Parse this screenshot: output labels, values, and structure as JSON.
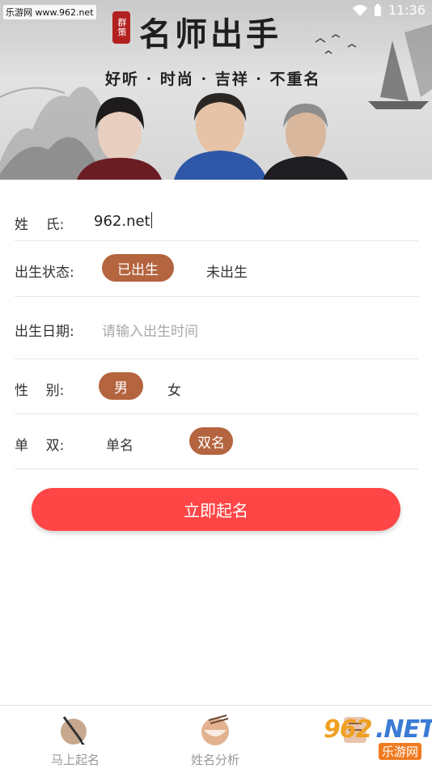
{
  "status_bar": {
    "watermark": "乐游网 www.962.net",
    "time": "11:36",
    "icons": [
      "wifi-icon",
      "battery-icon"
    ]
  },
  "banner": {
    "seal_text": "群策",
    "title": "名师出手",
    "slogan": "好听 · 时尚 · 吉祥 · 不重名"
  },
  "form": {
    "surname": {
      "label": "姓    氏:",
      "value": "962.net"
    },
    "birth_status": {
      "label": "出生状态:",
      "options": [
        "已出生",
        "未出生"
      ],
      "selected": "已出生"
    },
    "birth_date": {
      "label": "出生日期:",
      "placeholder": "请输入出生时间"
    },
    "gender": {
      "label": "性    别:",
      "options": [
        "男",
        "女"
      ],
      "selected": "男"
    },
    "name_length": {
      "label": "单    双:",
      "options": [
        "单名",
        "双名"
      ],
      "selected": "双名"
    }
  },
  "submit_label": "立即起名",
  "colors": {
    "accent": "#b4643f",
    "submit": "#ff4646",
    "nav_text": "#999999"
  },
  "bottom_nav": [
    {
      "label": "马上起名",
      "icon": "brush-icon"
    },
    {
      "label": "姓名分析",
      "icon": "bowl-icon"
    },
    {
      "label": "",
      "icon": "scroll-icon"
    }
  ],
  "watermark_bottom": {
    "part1": "962",
    "part2": ".NET",
    "part3": "乐游网"
  }
}
